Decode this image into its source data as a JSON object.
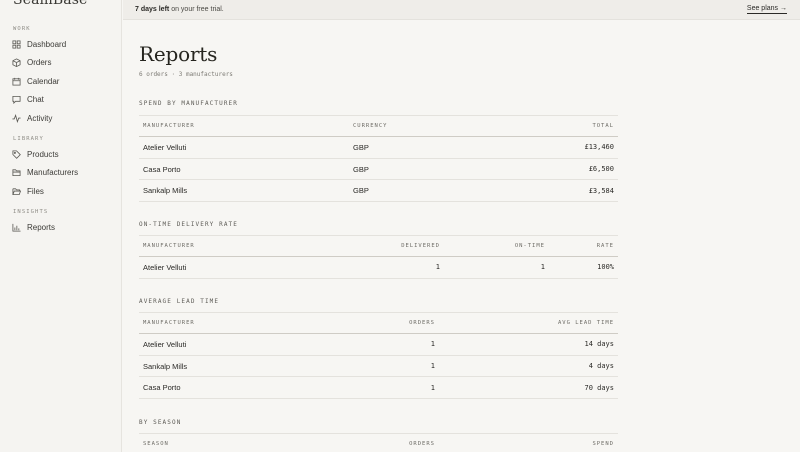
{
  "sidebar": {
    "brand": "SeamBase",
    "sections": [
      {
        "label": "WORK",
        "items": [
          {
            "label": "Dashboard",
            "icon": "grid-icon"
          },
          {
            "label": "Orders",
            "icon": "box-icon"
          },
          {
            "label": "Calendar",
            "icon": "calendar-icon"
          },
          {
            "label": "Chat",
            "icon": "chat-icon"
          },
          {
            "label": "Activity",
            "icon": "activity-icon"
          }
        ]
      },
      {
        "label": "LIBRARY",
        "items": [
          {
            "label": "Products",
            "icon": "tag-icon"
          },
          {
            "label": "Manufacturers",
            "icon": "folder-icon"
          },
          {
            "label": "Files",
            "icon": "folder-open-icon"
          }
        ]
      },
      {
        "label": "INSIGHTS",
        "items": [
          {
            "label": "Reports",
            "icon": "bar-chart-icon"
          }
        ]
      }
    ]
  },
  "banner": {
    "highlight": "7 days left",
    "rest": " on your free trial.",
    "link": "See plans →"
  },
  "page": {
    "title": "Reports",
    "subtitle": "6 orders · 3 manufacturers"
  },
  "spend": {
    "heading": "SPEND BY MANUFACTURER",
    "columns": [
      "MANUFACTURER",
      "CURRENCY",
      "TOTAL"
    ],
    "rows": [
      [
        "Atelier Velluti",
        "GBP",
        "£13,460"
      ],
      [
        "Casa Porto",
        "GBP",
        "£6,500"
      ],
      [
        "Sankalp Mills",
        "GBP",
        "£3,584"
      ]
    ]
  },
  "delivery": {
    "heading": "ON-TIME DELIVERY RATE",
    "columns": [
      "MANUFACTURER",
      "DELIVERED",
      "ON-TIME",
      "RATE"
    ],
    "rows": [
      [
        "Atelier Velluti",
        "1",
        "1",
        "100%"
      ]
    ]
  },
  "leadtime": {
    "heading": "AVERAGE LEAD TIME",
    "columns": [
      "MANUFACTURER",
      "ORDERS",
      "AVG LEAD TIME"
    ],
    "rows": [
      [
        "Atelier Velluti",
        "1",
        "14 days"
      ],
      [
        "Sankalp Mills",
        "1",
        "4 days"
      ],
      [
        "Casa Porto",
        "1",
        "70 days"
      ]
    ]
  },
  "season": {
    "heading": "BY SEASON",
    "columns": [
      "SEASON",
      "ORDERS",
      "SPEND"
    ]
  }
}
